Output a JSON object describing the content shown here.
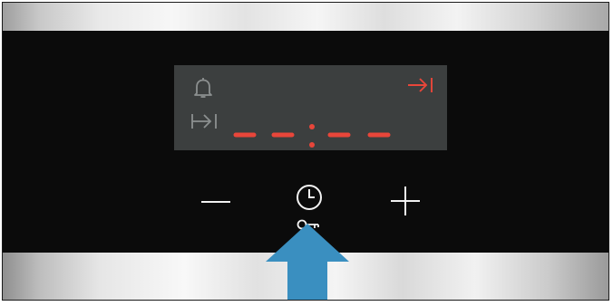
{
  "panel": {
    "display": {
      "time_text": "- - : - -",
      "icons": [
        "bell-icon",
        "time-duration-icon",
        "end-time-icon"
      ],
      "segment_color": "#e8463a",
      "icon_color": "#e8463a",
      "dim_icon_color": "#8c9090"
    },
    "buttons": [
      {
        "name": "minus-button",
        "icon": "minus-icon"
      },
      {
        "name": "clock-button",
        "icon": "clock-icon",
        "secondary_icon": "key-icon"
      },
      {
        "name": "plus-button",
        "icon": "plus-icon"
      }
    ],
    "indicator": {
      "icon": "arrow-up-icon",
      "color": "#3a8fc0"
    }
  }
}
